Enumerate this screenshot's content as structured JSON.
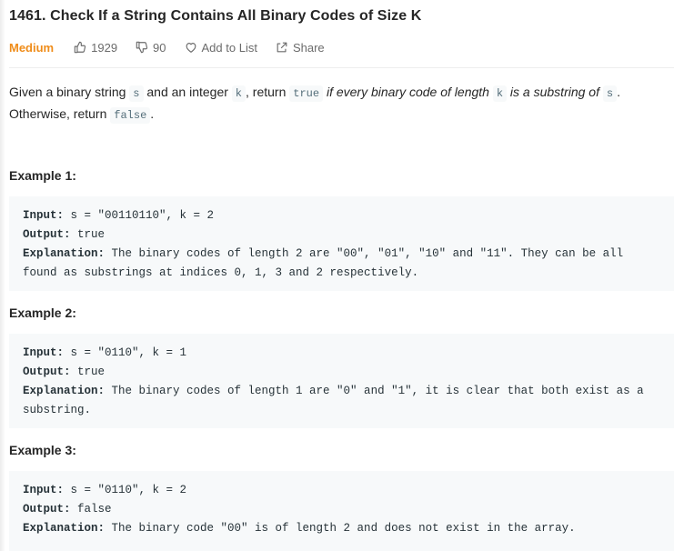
{
  "problem": {
    "title": "1461. Check If a String Contains All Binary Codes of Size K",
    "difficulty": "Medium",
    "likes": "1929",
    "dislikes": "90",
    "add_to_list": "Add to List",
    "share": "Share"
  },
  "description": {
    "p1": "Given a binary string ",
    "code_s": "s",
    "p2": " and an integer ",
    "code_k": "k",
    "p3": ", return ",
    "code_true": "true",
    "p4_italic": " if every binary code of length ",
    "p5_italic": " is a substring of ",
    "p6": ".",
    "p7": "Otherwise, return ",
    "code_false": "false",
    "p8": "."
  },
  "examples": [
    {
      "heading": "Example 1:",
      "input_label": "Input:",
      "input": " s = \"00110110\", k = 2",
      "output_label": "Output:",
      "output": " true",
      "explanation_label": "Explanation:",
      "explanation": " The binary codes of length 2 are \"00\", \"01\", \"10\" and \"11\". They can be all found as substrings at indices 0, 1, 3 and 2 respectively."
    },
    {
      "heading": "Example 2:",
      "input_label": "Input:",
      "input": " s = \"0110\", k = 1",
      "output_label": "Output:",
      "output": " true",
      "explanation_label": "Explanation:",
      "explanation": " The binary codes of length 1 are \"0\" and \"1\", it is clear that both exist as a substring."
    },
    {
      "heading": "Example 3:",
      "input_label": "Input:",
      "input": " s = \"0110\", k = 2",
      "output_label": "Output:",
      "output": " false",
      "explanation_label": "Explanation:",
      "explanation": " The binary code \"00\" is of length 2 and does not exist in the array."
    }
  ],
  "icons": {
    "like": "thumbs-up-icon",
    "dislike": "thumbs-down-icon",
    "add_to_list": "heart-icon",
    "share": "share-icon"
  },
  "colors": {
    "difficulty_medium": "#ef8c19",
    "code_bg": "#f7f9fa",
    "code_text": "#546e7a"
  }
}
